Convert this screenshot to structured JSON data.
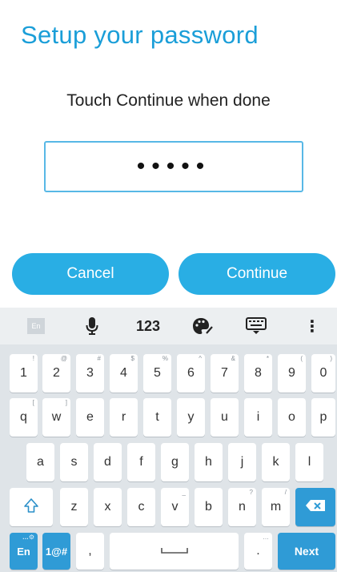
{
  "dialog": {
    "title": "Setup your password",
    "subtitle": "Touch Continue when done",
    "password_value": "•••••",
    "cancel_label": "Cancel",
    "continue_label": "Continue"
  },
  "keyboard": {
    "toolbar": {
      "lang_label": "En",
      "numbers_label": "123",
      "more_label": "⋮"
    },
    "row1": [
      {
        "label": "1",
        "hint": "!"
      },
      {
        "label": "2",
        "hint": "@"
      },
      {
        "label": "3",
        "hint": "#"
      },
      {
        "label": "4",
        "hint": "$"
      },
      {
        "label": "5",
        "hint": "%"
      },
      {
        "label": "6",
        "hint": "^"
      },
      {
        "label": "7",
        "hint": "&"
      },
      {
        "label": "8",
        "hint": "*"
      },
      {
        "label": "9",
        "hint": "("
      },
      {
        "label": "0",
        "hint": ")"
      }
    ],
    "row2": [
      {
        "label": "q",
        "hint": "["
      },
      {
        "label": "w",
        "hint": "]"
      },
      {
        "label": "e",
        "hint": ""
      },
      {
        "label": "r",
        "hint": ""
      },
      {
        "label": "t",
        "hint": ""
      },
      {
        "label": "y",
        "hint": ""
      },
      {
        "label": "u",
        "hint": ""
      },
      {
        "label": "i",
        "hint": ""
      },
      {
        "label": "o",
        "hint": ""
      },
      {
        "label": "p",
        "hint": ""
      }
    ],
    "row3": [
      {
        "label": "a",
        "hint": ""
      },
      {
        "label": "s",
        "hint": ""
      },
      {
        "label": "d",
        "hint": ""
      },
      {
        "label": "f",
        "hint": ""
      },
      {
        "label": "g",
        "hint": ""
      },
      {
        "label": "h",
        "hint": ""
      },
      {
        "label": "j",
        "hint": ""
      },
      {
        "label": "k",
        "hint": ""
      },
      {
        "label": "l",
        "hint": ""
      }
    ],
    "row4": [
      {
        "label": "z",
        "hint": ""
      },
      {
        "label": "x",
        "hint": ""
      },
      {
        "label": "c",
        "hint": ""
      },
      {
        "label": "v",
        "hint": "_"
      },
      {
        "label": "b",
        "hint": ""
      },
      {
        "label": "n",
        "hint": "?"
      },
      {
        "label": "m",
        "hint": "/"
      }
    ],
    "bottom": {
      "lang_label": "En",
      "symbols_label": "1@#",
      "comma_label": ",",
      "period_label": ".",
      "next_label": "Next"
    }
  },
  "colors": {
    "accent": "#29aee4",
    "title": "#1a9ed8",
    "keyboard_bg": "#dfe4e8"
  }
}
